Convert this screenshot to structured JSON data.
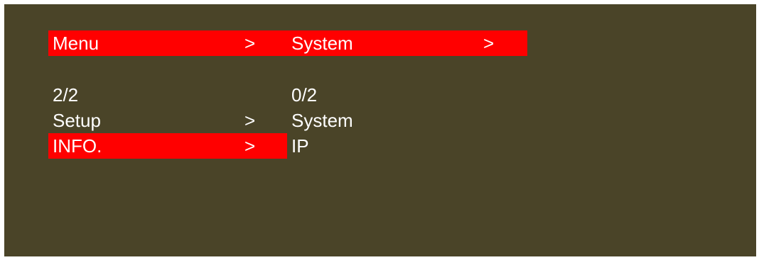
{
  "header": {
    "title_left": "Menu",
    "sep_left": ">",
    "title_right": "System",
    "sep_right": ">"
  },
  "left_column": {
    "counter": "2/2",
    "items": [
      {
        "label": "Setup",
        "arrow": ">",
        "selected": false
      },
      {
        "label": "INFO.",
        "arrow": ">",
        "selected": true
      }
    ]
  },
  "right_column": {
    "counter": "0/2",
    "items": [
      {
        "label": "System"
      },
      {
        "label": "IP"
      }
    ]
  },
  "colors": {
    "background": "#4a4428",
    "highlight": "#ff0000",
    "text": "#ffffff"
  }
}
